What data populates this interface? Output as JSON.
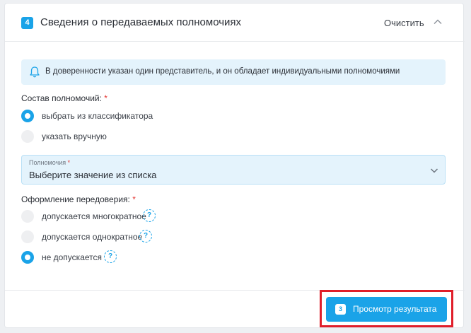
{
  "section": {
    "step_number": "4",
    "title": "Сведения о передаваемых полномочиях",
    "clear_label": "Очистить"
  },
  "info": {
    "text": "В доверенности указан один представитель, и он обладает индивидуальными полномочиями"
  },
  "powers": {
    "label": "Состав полномочий:",
    "required_mark": "*",
    "options": [
      {
        "label": "выбрать из классификатора",
        "checked": true
      },
      {
        "label": "указать вручную",
        "checked": false
      }
    ]
  },
  "powers_select": {
    "label": "Полномочия",
    "required_mark": "*",
    "placeholder": "Выберите значение из списка"
  },
  "subdelegation": {
    "label": "Оформление передоверия:",
    "required_mark": "*",
    "help_glyph": "?",
    "options": [
      {
        "label": "допускается многократное",
        "checked": false
      },
      {
        "label": "допускается однократное",
        "checked": false
      },
      {
        "label": "не допускается",
        "checked": true
      }
    ]
  },
  "footer": {
    "result_button_badge": "3",
    "result_button_label": "Просмотр результата"
  },
  "colors": {
    "accent": "#1aa3e8",
    "info_background": "#e4f3fc",
    "required": "#e53935",
    "highlight_frame": "#e01e2a"
  }
}
